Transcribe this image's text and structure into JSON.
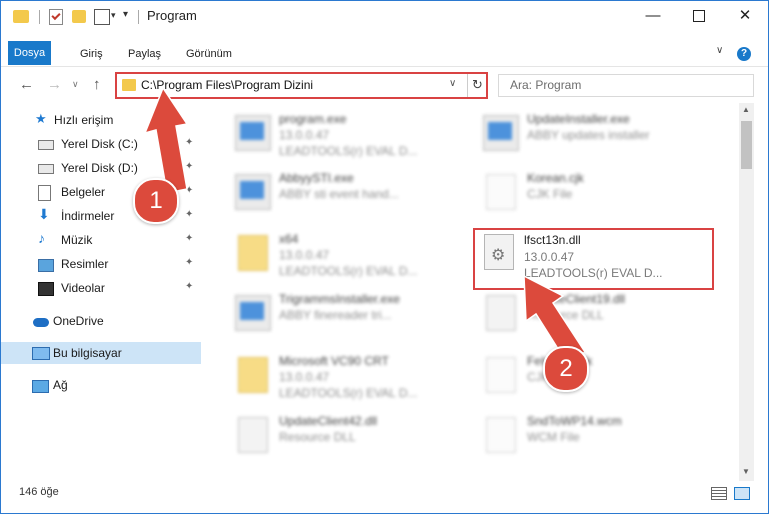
{
  "window": {
    "title": "Program",
    "minimize": "—",
    "close": "✕"
  },
  "ribbon": {
    "tabs": [
      "Dosya",
      "Giriş",
      "Paylaş",
      "Görünüm"
    ],
    "help": "?",
    "chevron": "∨"
  },
  "address": {
    "path": "C:\\Program Files\\Program Dizini",
    "dropdown": "∨",
    "refresh": "↻"
  },
  "search": {
    "placeholder": "Ara: Program"
  },
  "nav": {
    "back": "←",
    "forward": "→",
    "recent": "∨",
    "up": "↑"
  },
  "sidebar": {
    "quick_access": "Hızlı erişim",
    "items": [
      {
        "label": "Yerel Disk (C:)",
        "icon": "drive-icon"
      },
      {
        "label": "Yerel Disk (D:)",
        "icon": "drive-icon"
      },
      {
        "label": "Belgeler",
        "icon": "documents-icon"
      },
      {
        "label": "İndirmeler",
        "icon": "downloads-icon"
      },
      {
        "label": "Müzik",
        "icon": "music-icon"
      },
      {
        "label": "Resimler",
        "icon": "pictures-icon"
      },
      {
        "label": "Videolar",
        "icon": "videos-icon"
      }
    ],
    "onedrive": "OneDrive",
    "this_pc": "Bu bilgisayar",
    "network": "Ağ",
    "pin": "📌"
  },
  "files": [
    {
      "name": "program.exe",
      "line1": "13.0.0.47",
      "line2": "LEADTOOLS(r) EVAL D...",
      "type": "exe"
    },
    {
      "name": "UpdateInstaller.exe",
      "line1": "ABBY updates installer",
      "line2": "",
      "type": "exe"
    },
    {
      "name": "AbbyySTI.exe",
      "line1": "ABBY sti event hand...",
      "line2": "",
      "type": "exe"
    },
    {
      "name": "Korean.cjk",
      "line1": "CJK File",
      "line2": "",
      "type": "blank"
    },
    {
      "name": "x64",
      "line1": "13.0.0.47",
      "line2": "LEADTOOLS(r) EVAL D...",
      "type": "folder"
    },
    {
      "name": "lfsct13n.dll",
      "line1": "13.0.0.47",
      "line2": "LEADTOOLS(r) EVAL D...",
      "type": "dll"
    },
    {
      "name": "TrigrammsInstaller.exe",
      "line1": "ABBY finereader tri...",
      "line2": "",
      "type": "exe"
    },
    {
      "name": "UpdateClient19.dll",
      "line1": "Resource DLL",
      "line2": "",
      "type": "dll"
    },
    {
      "name": "Microsoft VC90 CRT",
      "line1": "13.0.0.47",
      "line2": "LEADTOOLS(r) EVAL D...",
      "type": "folder"
    },
    {
      "name": "FeImage.cjk",
      "line1": "CJK File",
      "line2": "",
      "type": "blank"
    },
    {
      "name": "UpdateClient42.dll",
      "line1": "Resource DLL",
      "line2": "",
      "type": "dll"
    },
    {
      "name": "SndToWP14.wcm",
      "line1": "WCM File",
      "line2": "",
      "type": "blank"
    }
  ],
  "status": {
    "count": "146 öğe"
  },
  "annotations": {
    "step1": "1",
    "step2": "2",
    "color": "#dc4a3c"
  },
  "scroll": {
    "up": "▲",
    "down": "▼"
  }
}
